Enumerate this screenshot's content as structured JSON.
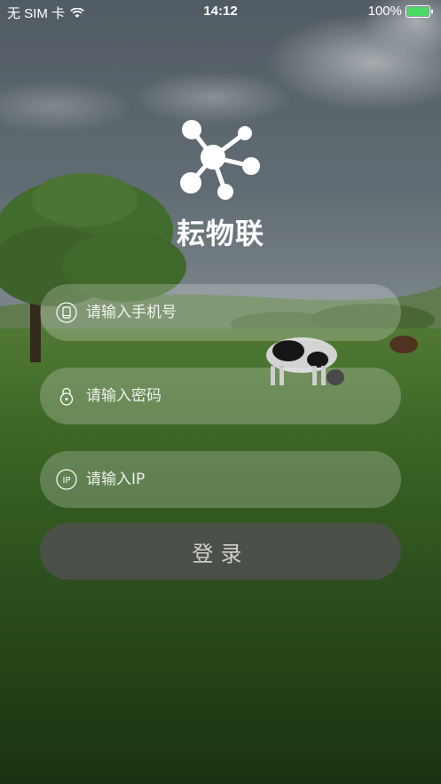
{
  "status_bar": {
    "carrier": "无 SIM 卡",
    "time": "14:12",
    "battery": "100%",
    "battery_color": "#4cd964",
    "wifi_icon": "wifi-icon"
  },
  "brand": {
    "name": "耘物联",
    "logo_icon": "network-molecule-icon"
  },
  "form": {
    "phone": {
      "placeholder": "请输入手机号",
      "value": "",
      "icon": "phone-icon"
    },
    "password": {
      "placeholder": "请输入密码",
      "value": "",
      "icon": "lock-icon"
    },
    "ip": {
      "placeholder": "请输入IP",
      "value": "",
      "icon": "ip-icon",
      "icon_text": "IP"
    },
    "login_label": "登录"
  }
}
